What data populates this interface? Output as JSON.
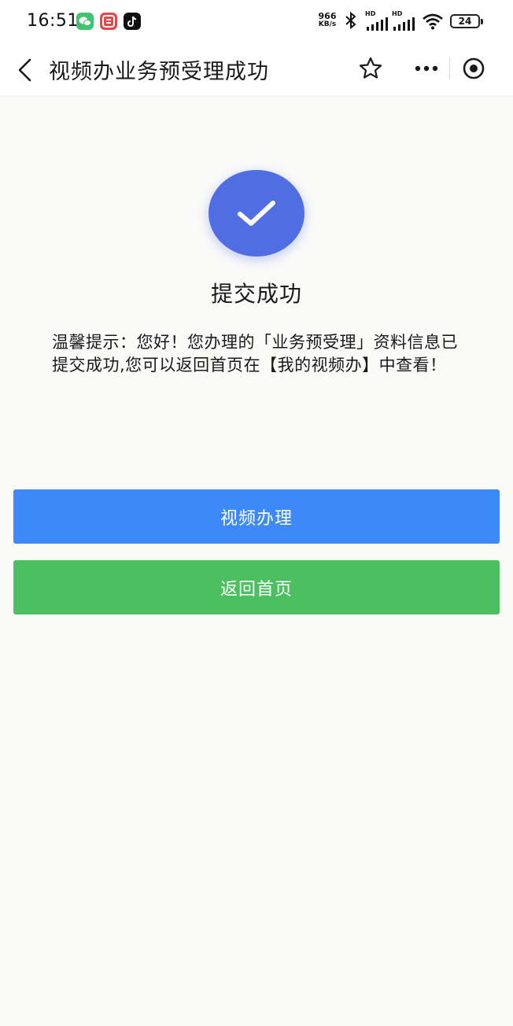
{
  "status_bar": {
    "time": "16:51",
    "net_speed_value": "966",
    "net_speed_unit": "KB/s",
    "signal_label_1": "HD",
    "signal_label_2": "HD",
    "battery": "24",
    "icons": [
      "wechat-icon",
      "taobao-icon",
      "tiktok-icon",
      "bluetooth-icon",
      "signal-icon",
      "wifi-icon",
      "battery-icon"
    ]
  },
  "nav": {
    "title": "视频办业务预受理成功",
    "icons": [
      "back-icon",
      "star-icon",
      "more-icon",
      "close-target-icon"
    ]
  },
  "result": {
    "icon": "check-icon",
    "accent_color": "#4f6ee4",
    "title": "提交成功",
    "tip": "温馨提示：您好！您办理的「业务预受理」资料信息已提交成功,您可以返回首页在【我的视频办】中查看！"
  },
  "buttons": {
    "video_label": "视频办理",
    "video_color": "#3d89f7",
    "home_label": "返回首页",
    "home_color": "#4cbf61"
  }
}
